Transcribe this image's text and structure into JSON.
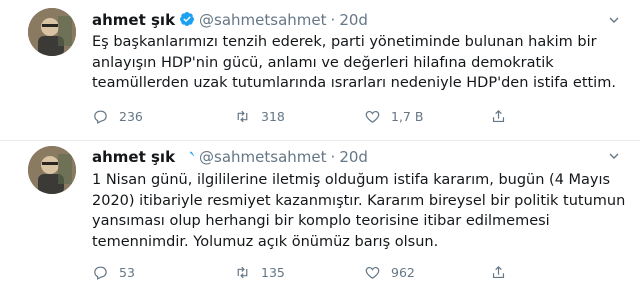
{
  "tweets": [
    {
      "author_name": "ahmet şık",
      "handle": "@sahmetsahmet",
      "separator": "·",
      "time": "20d",
      "text": "Eş başkanlarımızı tenzih ederek, parti yönetiminde bulunan hakim bir\nanlayışın HDP'nin gücü, anlamı ve değerleri hilafına demokratik\nteamüllerden uzak tutumlarında ısrarları nedeniyle HDP'den istifa ettim.",
      "replies": "236",
      "retweets": "318",
      "likes": "1,7 B"
    },
    {
      "author_name": "ahmet şık",
      "handle": "@sahmetsahmet",
      "separator": "·",
      "time": "20d",
      "text": "1 Nisan günü, ilgililerine iletmiş olduğum istifa kararım, bugün (4 Mayıs\n2020) itibariyle resmiyet kazanmıştır. Kararım bireysel bir politik tutumun\nyansıması olup herhangi bir komplo teorisine itibar edilmemesi\ntemennimdir. Yolumuz açık önümüz barış olsun.",
      "replies": "53",
      "retweets": "135",
      "likes": "962"
    }
  ],
  "colors": {
    "verified": "#1da1f2",
    "secondary_text": "#657786",
    "primary_text": "#14171a",
    "divider": "#e6ecf0"
  },
  "icons": [
    "verified-badge-icon",
    "chevron-down-icon",
    "reply-icon",
    "retweet-icon",
    "like-icon",
    "share-icon"
  ]
}
